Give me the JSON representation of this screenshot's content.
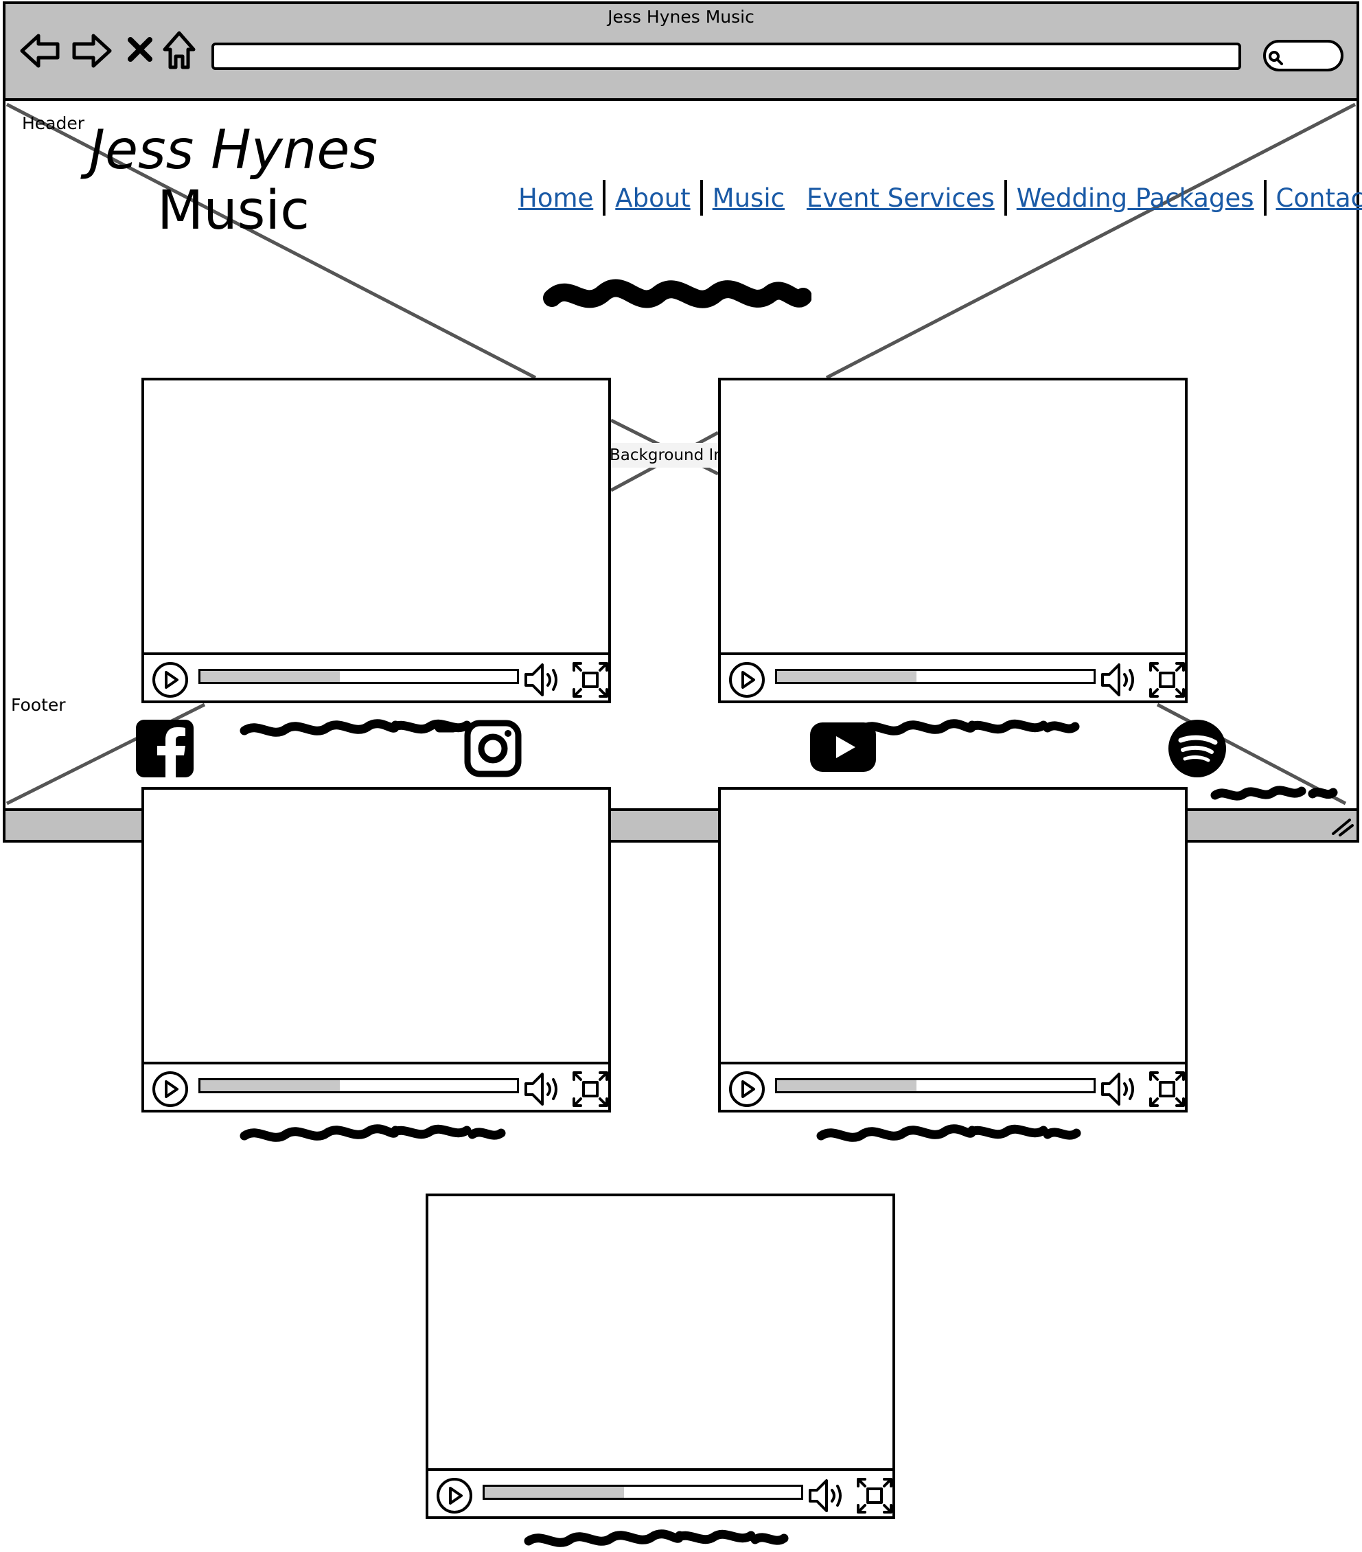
{
  "window": {
    "title": "Jess Hynes Music"
  },
  "labels": {
    "header": "Header",
    "footer": "Footer",
    "background_image": "Background Image"
  },
  "brand": {
    "line1": "Jess Hynes",
    "line2": "Music"
  },
  "nav": {
    "items": [
      "Home",
      "About",
      "Music",
      "Event Services",
      "Wedding Packages",
      "Contact"
    ]
  },
  "icons": {
    "toolbar": [
      "back-arrow-icon",
      "forward-arrow-icon",
      "close-x-icon",
      "home-icon",
      "search-icon"
    ],
    "social": [
      "facebook-icon",
      "instagram-icon",
      "youtube-icon",
      "spotify-icon"
    ],
    "video_controls": [
      "play-icon",
      "volume-icon",
      "fullscreen-icon"
    ]
  },
  "videos": [
    {
      "progress": 0.44
    },
    {
      "progress": 0.44
    },
    {
      "progress": 0.44
    },
    {
      "progress": 0.44
    },
    {
      "progress": 0.44
    }
  ],
  "colors": {
    "chrome": "#c0c0c0",
    "link": "#1a5aa6",
    "progress_fill": "#c8c8c8",
    "placeholder_cross": "#555555"
  }
}
